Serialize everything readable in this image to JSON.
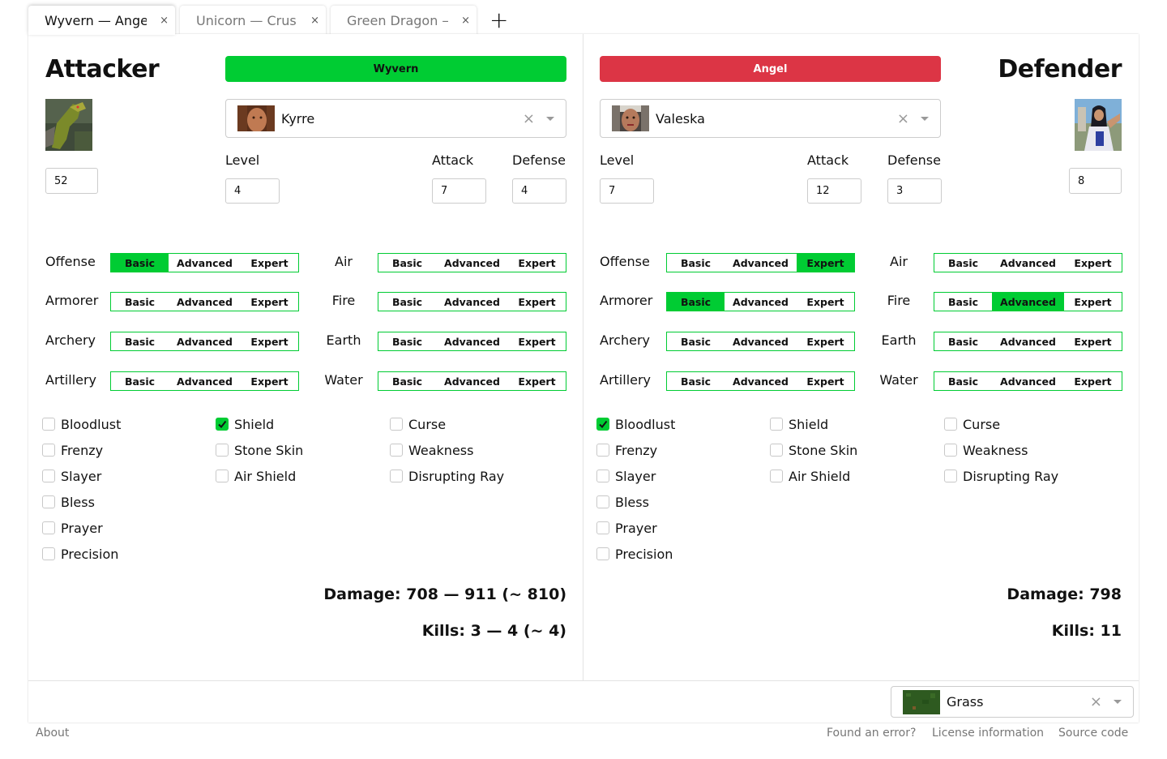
{
  "tabs": [
    {
      "label": "Wyvern — Angel",
      "active": true
    },
    {
      "label": "Unicorn — Crus...",
      "active": false
    },
    {
      "label": "Green Dragon —...",
      "active": false
    }
  ],
  "tab_add_label": "+",
  "tab_close_label": "×",
  "attacker": {
    "title": "Attacker",
    "unit": {
      "name": "Wyvern",
      "color": "#00cc33",
      "count": "52"
    },
    "hero": {
      "name": "Kyrre",
      "clear_label": "×"
    },
    "labels": {
      "level": "Level",
      "attack": "Attack",
      "defense": "Defense"
    },
    "level": "4",
    "attack": "7",
    "defense": "4",
    "skills": [
      {
        "name": "Offense",
        "selected": "Basic"
      },
      {
        "name": "Armorer",
        "selected": null
      },
      {
        "name": "Archery",
        "selected": null
      },
      {
        "name": "Artillery",
        "selected": null
      },
      {
        "name": "Air",
        "selected": null
      },
      {
        "name": "Fire",
        "selected": null
      },
      {
        "name": "Earth",
        "selected": null
      },
      {
        "name": "Water",
        "selected": null
      }
    ],
    "spells": [
      {
        "name": "Bloodlust",
        "checked": false
      },
      {
        "name": "Frenzy",
        "checked": false
      },
      {
        "name": "Slayer",
        "checked": false
      },
      {
        "name": "Bless",
        "checked": false
      },
      {
        "name": "Prayer",
        "checked": false
      },
      {
        "name": "Precision",
        "checked": false
      },
      {
        "name": "Shield",
        "checked": true
      },
      {
        "name": "Stone Skin",
        "checked": false
      },
      {
        "name": "Air Shield",
        "checked": false
      },
      {
        "name": "Curse",
        "checked": false
      },
      {
        "name": "Weakness",
        "checked": false
      },
      {
        "name": "Disrupting Ray",
        "checked": false
      }
    ],
    "damage": "Damage: 708 — 911 (~ 810)",
    "kills": "Kills: 3 — 4 (~ 4)"
  },
  "defender": {
    "title": "Defender",
    "unit": {
      "name": "Angel",
      "color": "#dc3545",
      "count": "8"
    },
    "hero": {
      "name": "Valeska",
      "clear_label": "×"
    },
    "labels": {
      "level": "Level",
      "attack": "Attack",
      "defense": "Defense"
    },
    "level": "7",
    "attack": "12",
    "defense": "3",
    "skills": [
      {
        "name": "Offense",
        "selected": "Expert"
      },
      {
        "name": "Armorer",
        "selected": "Basic"
      },
      {
        "name": "Archery",
        "selected": null
      },
      {
        "name": "Artillery",
        "selected": null
      },
      {
        "name": "Air",
        "selected": null
      },
      {
        "name": "Fire",
        "selected": "Advanced"
      },
      {
        "name": "Earth",
        "selected": null
      },
      {
        "name": "Water",
        "selected": null
      }
    ],
    "spells": [
      {
        "name": "Bloodlust",
        "checked": true
      },
      {
        "name": "Frenzy",
        "checked": false
      },
      {
        "name": "Slayer",
        "checked": false
      },
      {
        "name": "Bless",
        "checked": false
      },
      {
        "name": "Prayer",
        "checked": false
      },
      {
        "name": "Precision",
        "checked": false
      },
      {
        "name": "Shield",
        "checked": false
      },
      {
        "name": "Stone Skin",
        "checked": false
      },
      {
        "name": "Air Shield",
        "checked": false
      },
      {
        "name": "Curse",
        "checked": false
      },
      {
        "name": "Weakness",
        "checked": false
      },
      {
        "name": "Disrupting Ray",
        "checked": false
      }
    ],
    "damage": "Damage: 798",
    "kills": "Kills: 11"
  },
  "skill_levels": [
    "Basic",
    "Advanced",
    "Expert"
  ],
  "terrain": {
    "name": "Grass",
    "clear_label": "×"
  },
  "footer": {
    "about": "About",
    "found_error": "Found an error?",
    "license": "License information",
    "source": "Source code"
  }
}
